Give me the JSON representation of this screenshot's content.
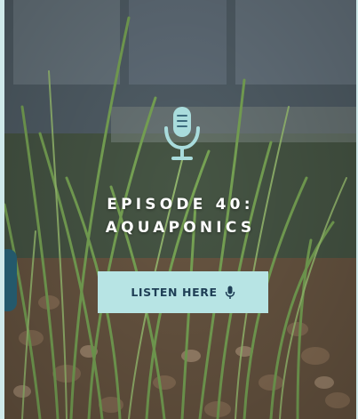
{
  "episode": {
    "title_line1": "EPISODE 40:",
    "title_line2": "AQUAPONICS"
  },
  "cta": {
    "label": "LISTEN HERE"
  },
  "icons": {
    "header": "microphone-icon",
    "cta": "microphone-icon"
  },
  "colors": {
    "accent": "#b7e4e4",
    "cta_text": "#1f3f56",
    "title": "#ffffff"
  }
}
